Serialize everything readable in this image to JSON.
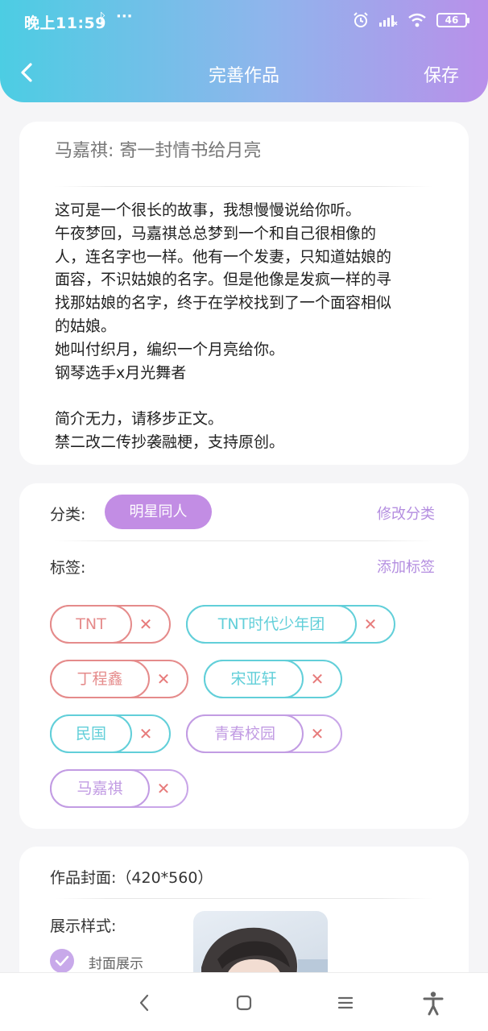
{
  "status_bar": {
    "time": "晚上11:59",
    "bluetooth": "ᛒ",
    "more": "···",
    "battery": "46"
  },
  "nav": {
    "title": "完善作品",
    "save_label": "保存"
  },
  "work": {
    "title": "马嘉祺: 寄一封情书给月亮",
    "intro_lines": [
      "这可是一个很长的故事，我想慢慢说给你听。",
      "午夜梦回，马嘉祺总总梦到一个和自己很相像的",
      "人，连名字也一样。他有一个发妻，只知道姑娘的",
      "面容，不识姑娘的名字。但是他像是发疯一样的寻",
      "找那姑娘的名字，终于在学校找到了一个面容相似",
      "的姑娘。",
      "她叫付织月，编织一个月亮给你。",
      "钢琴选手x月光舞者",
      "",
      "简介无力，请移步正文。",
      "禁二改二传抄袭融梗，支持原创。"
    ]
  },
  "category": {
    "label": "分类:",
    "value": "明星同人",
    "edit_label": "修改分类"
  },
  "tags": {
    "label": "标签:",
    "add_label": "添加标签",
    "items": [
      {
        "text": "TNT",
        "color": "#e58b8b"
      },
      {
        "text": "TNT时代少年团",
        "color": "#62cfd9"
      },
      {
        "text": "丁程鑫",
        "color": "#e58b8b"
      },
      {
        "text": "宋亚轩",
        "color": "#62cfd9"
      },
      {
        "text": "民国",
        "color": "#62cfd9"
      },
      {
        "text": "青春校园",
        "color": "#c9a6e8"
      },
      {
        "text": "马嘉祺",
        "color": "#c9a6e8"
      }
    ],
    "remove_glyph": "✕"
  },
  "cover": {
    "label": "作品封面:（420*560）",
    "style_label": "展示样式:",
    "option_label": "封面展示"
  },
  "colors": {
    "accent": "#c28de4",
    "header_start": "#4ccde3",
    "header_end": "#b990ea",
    "remove_x": "#e77b7b"
  }
}
